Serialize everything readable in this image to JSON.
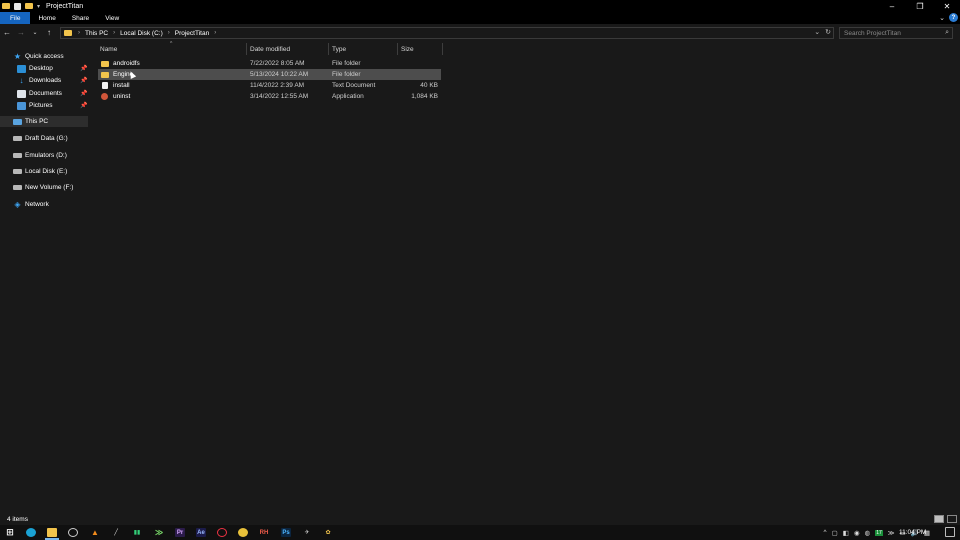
{
  "window": {
    "title": "ProjectTitan",
    "quick_access_down": "▾",
    "minimize": "–",
    "maximize": "❐",
    "close": "✕"
  },
  "ribbon": {
    "tabs": [
      {
        "label": "File"
      },
      {
        "label": "Home"
      },
      {
        "label": "Share"
      },
      {
        "label": "View"
      }
    ],
    "expand": "⌄",
    "help": "?"
  },
  "address": {
    "back": "←",
    "forward": "→",
    "recent": "⌄",
    "up": "↑",
    "breadcrumb": [
      "This PC",
      "Local Disk (C:)",
      "ProjectTitan"
    ],
    "separator": "›",
    "dropdown": "⌄",
    "refresh": "↻"
  },
  "search": {
    "placeholder": "Search ProjectTitan"
  },
  "sidebar": {
    "items": [
      {
        "label": "Quick access"
      },
      {
        "label": "Desktop"
      },
      {
        "label": "Downloads"
      },
      {
        "label": "Documents"
      },
      {
        "label": "Pictures"
      },
      {
        "label": "This PC"
      },
      {
        "label": "Draft Data (G:)"
      },
      {
        "label": "Emulators (D:)"
      },
      {
        "label": "Local Disk (E:)"
      },
      {
        "label": "New Volume (F:)"
      },
      {
        "label": "Network"
      }
    ],
    "pin_glyph": "📌"
  },
  "columns": {
    "name": "Name",
    "date": "Date modified",
    "type": "Type",
    "size": "Size"
  },
  "files": [
    {
      "name": "androidfs",
      "date": "7/22/2022 8:05 AM",
      "type": "File folder",
      "size": "",
      "icon": "folder-icon"
    },
    {
      "name": "Engine",
      "date": "5/13/2024 10:22 AM",
      "type": "File folder",
      "size": "",
      "icon": "folder-icon"
    },
    {
      "name": "install",
      "date": "11/4/2022 2:39 AM",
      "type": "Text Document",
      "size": "40 KB",
      "icon": "text-document-icon"
    },
    {
      "name": "uninst",
      "date": "3/14/2022 12:55 AM",
      "type": "Application",
      "size": "1,084 KB",
      "icon": "application-icon"
    }
  ],
  "status": {
    "item_count": "4 items"
  },
  "taskbar": {
    "start": "⊞",
    "rh": "RH",
    "pr": "Pr",
    "ae": "Ae",
    "ps": "Ps",
    "tray_badge": "17",
    "clock": "11:04 PM"
  },
  "colors": {
    "accent": "#1565c0",
    "folder": "#f2c44c",
    "background": "#191919",
    "hover_row": "#4d4d4d"
  }
}
